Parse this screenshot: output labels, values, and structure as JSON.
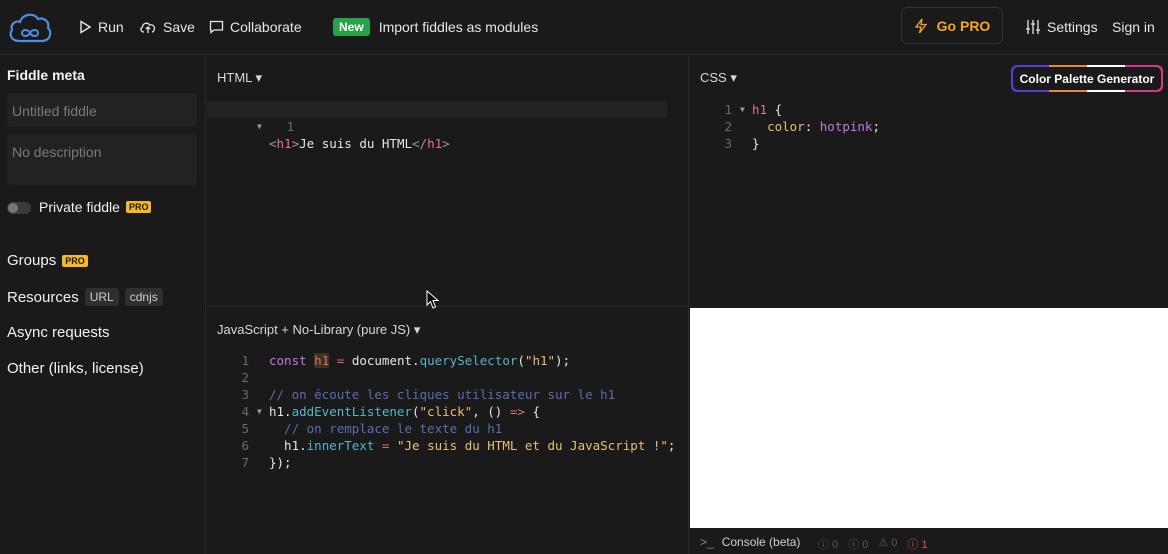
{
  "topbar": {
    "run_label": "Run",
    "save_label": "Save",
    "collaborate_label": "Collaborate",
    "new_badge": "New",
    "announcement": "Import fiddles as modules",
    "gopro_label": "Go PRO",
    "settings_label": "Settings",
    "signin_label": "Sign in"
  },
  "sidebar": {
    "title": "Fiddle meta",
    "title_placeholder": "Untitled fiddle",
    "description_placeholder": "No description",
    "private_label": "Private fiddle",
    "pro_badge": "PRO",
    "groups_label": "Groups",
    "resources_label": "Resources",
    "resources_chips": [
      "URL",
      "cdnjs"
    ],
    "async_label": "Async requests",
    "other_label": "Other (links, license)"
  },
  "panels": {
    "html_label": "HTML",
    "css_label": "CSS",
    "js_label": "JavaScript + No-Library (pure JS)",
    "palette_button": "Color Palette Generator"
  },
  "code": {
    "html": [
      "<h1>Je suis du HTML</h1>"
    ],
    "css": [
      "h1 {",
      "  color: hotpink;",
      "}"
    ],
    "js": [
      "const h1 = document.querySelector(\"h1\");",
      "",
      "// on écoute les cliques utilisateur sur le h1",
      "h1.addEventListener(\"click\", () => {",
      "  // on remplace le texte du h1",
      "  h1.innerText = \"Je suis du HTML et du JavaScript !\";",
      "});"
    ]
  },
  "console": {
    "label": "Console (beta)",
    "prompt_symbol": ">_",
    "counts": [
      "0",
      "0",
      "0",
      "1"
    ]
  },
  "colors": {
    "accent_pro": "#f5b629",
    "gopro": "#f5a623",
    "new_badge": "#2aa04a",
    "error": "#e05252"
  }
}
